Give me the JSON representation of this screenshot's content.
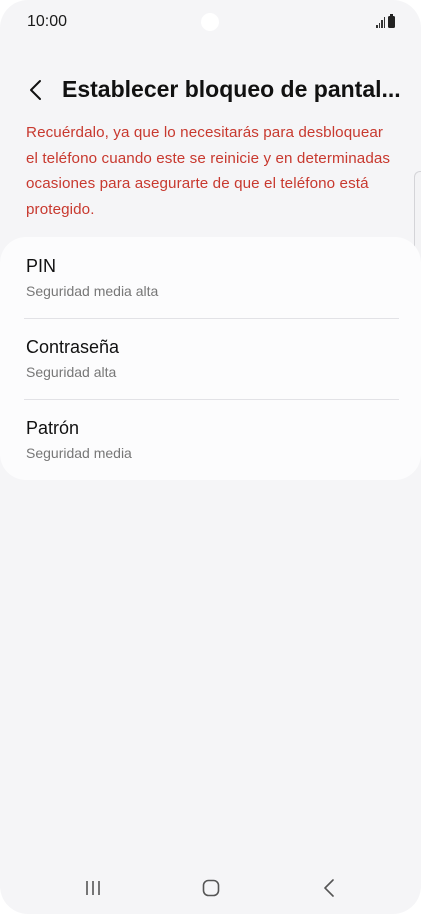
{
  "status_bar": {
    "time": "10:00"
  },
  "header": {
    "title": "Establecer bloqueo de pantal..."
  },
  "warning_text": "Recuérdalo, ya que lo necesitarás para desbloquear el teléfono cuando este se reinicie y en determinadas ocasiones para asegurarte de que el teléfono está protegido.",
  "options": [
    {
      "title": "PIN",
      "subtitle": "Seguridad media alta"
    },
    {
      "title": "Contraseña",
      "subtitle": "Seguridad alta"
    },
    {
      "title": "Patrón",
      "subtitle": "Seguridad media"
    }
  ],
  "colors": {
    "warning": "#c8392f",
    "background": "#f5f5f7",
    "card": "#fcfcfd"
  },
  "icons": {
    "back": "chevron-left-icon",
    "recents": "recents-icon",
    "home": "home-icon",
    "nav_back": "back-icon",
    "signal": "signal-icon",
    "battery": "battery-icon"
  }
}
